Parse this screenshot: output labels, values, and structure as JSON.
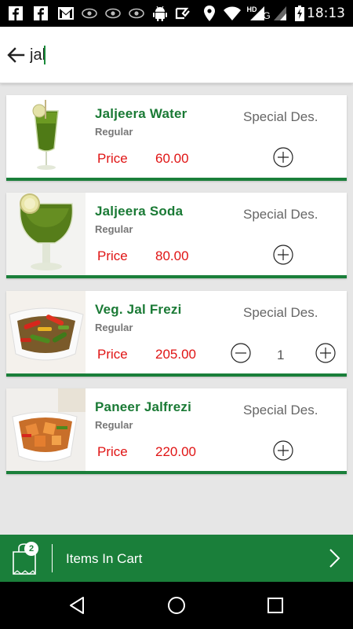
{
  "status_bar": {
    "time": "18:13",
    "network_label": "HD",
    "network_type": "G",
    "icons": [
      "facebook-icon",
      "facebook-icon",
      "gmail-icon",
      "eye-icon",
      "eye-icon",
      "eye-icon",
      "android-icon",
      "check-icon",
      "location-icon",
      "wifi-icon",
      "signal-icon",
      "battery-charging-icon"
    ]
  },
  "search": {
    "value": "jal",
    "placeholder": ""
  },
  "items": [
    {
      "name": "Jaljeera Water",
      "variant": "Regular",
      "price_label": "Price",
      "price": "60.00",
      "special_label": "Special Des.",
      "quantity": null
    },
    {
      "name": "Jaljeera Soda",
      "variant": "Regular",
      "price_label": "Price",
      "price": "80.00",
      "special_label": "Special Des.",
      "quantity": null
    },
    {
      "name": "Veg. Jal Frezi",
      "variant": "Regular",
      "price_label": "Price",
      "price": "205.00",
      "special_label": "Special Des.",
      "quantity": "1"
    },
    {
      "name": "Paneer Jalfrezi",
      "variant": "Regular",
      "price_label": "Price",
      "price": "220.00",
      "special_label": "Special Des.",
      "quantity": null
    }
  ],
  "cart": {
    "count": "2",
    "label": "Items In Cart"
  },
  "colors": {
    "accent_green": "#1a7f3a",
    "name_green": "#1a7a35",
    "price_red": "#e01414",
    "background": "#e6e6e6"
  }
}
